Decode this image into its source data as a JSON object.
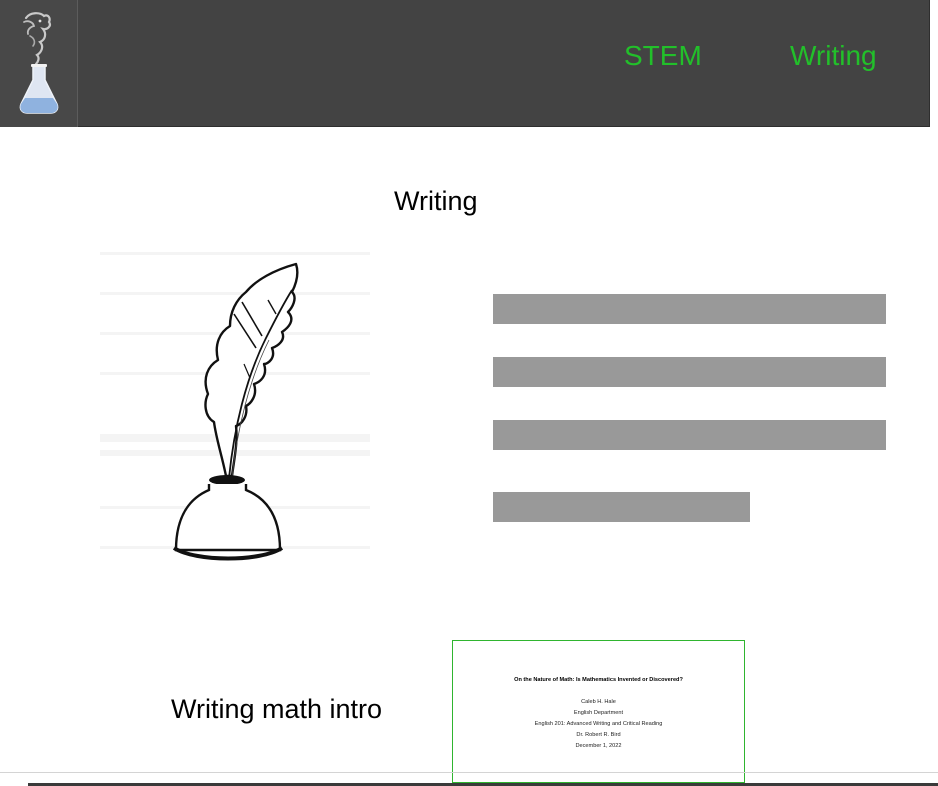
{
  "header": {
    "logo": "dragon-flask-logo",
    "nav": [
      {
        "label": "STEM"
      },
      {
        "label": "Writing"
      }
    ]
  },
  "main": {
    "section_title": "Writing",
    "illustration": "quill-inkwell-icon",
    "document": {
      "label": "Writing math intro",
      "thumbnail": {
        "title": "On the Nature of Math: Is Mathematics Invented or Discovered?",
        "lines": [
          "Caleb H. Hale",
          "English Department",
          "English 201: Advanced Writing and Critical Reading",
          "Dr. Robert R. Bird",
          "December 1, 2022"
        ]
      }
    }
  },
  "colors": {
    "header_bg": "#434343",
    "nav_link": "#22c02a",
    "placeholder_bar": "#999999",
    "thumb_border": "#2fb52f"
  }
}
